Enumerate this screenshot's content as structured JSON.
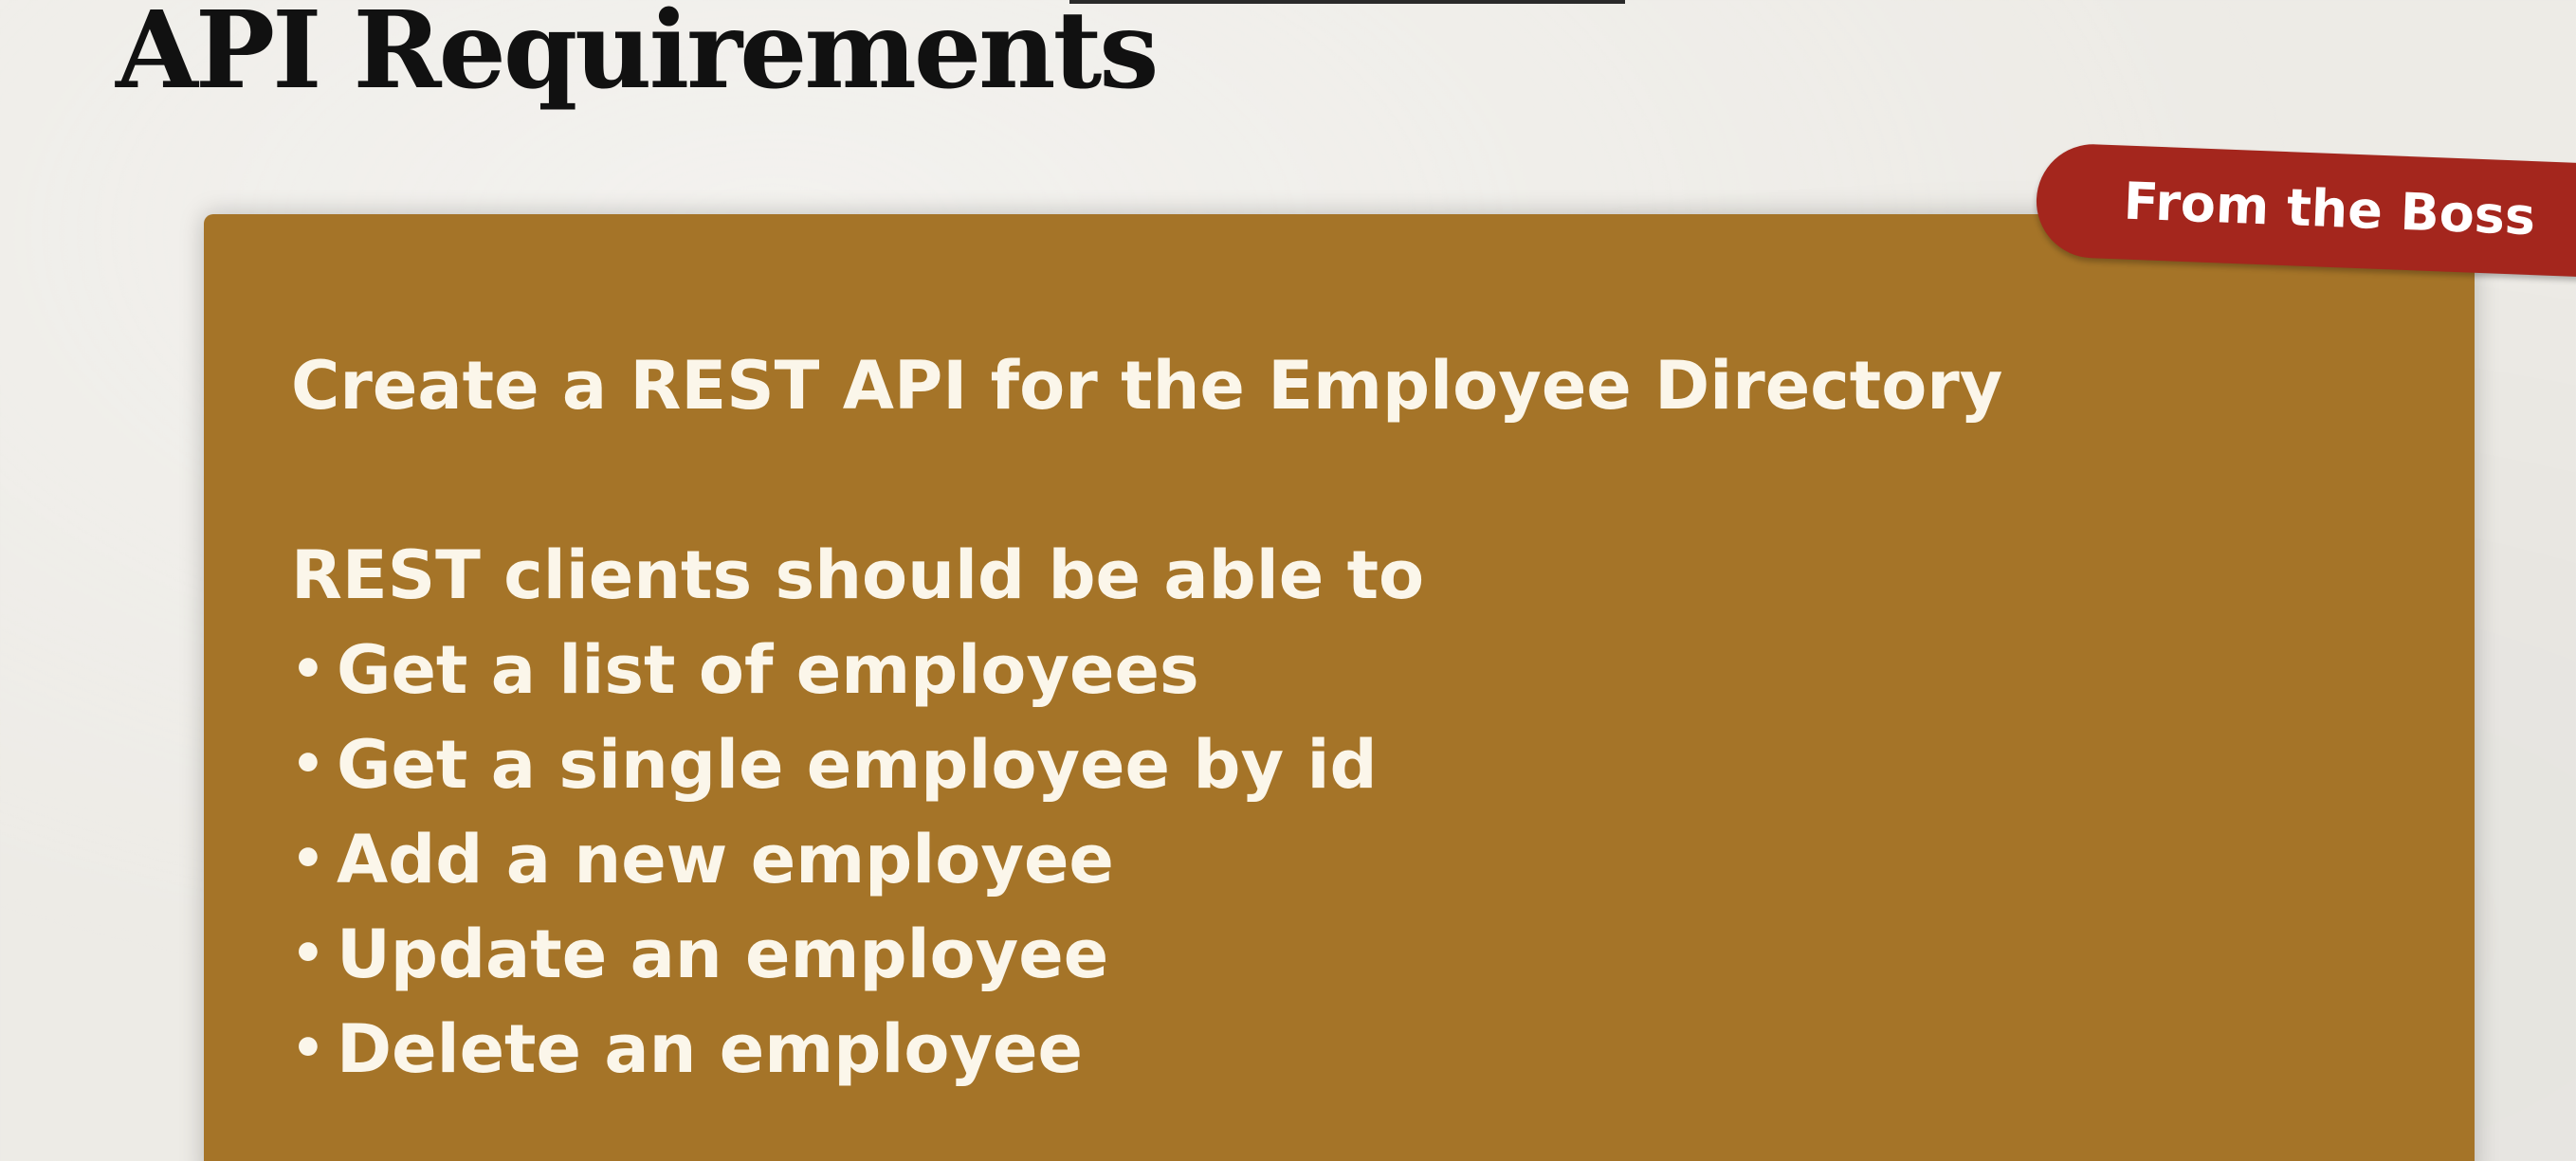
{
  "slide": {
    "title": "API Requirements"
  },
  "badge": {
    "label": "From the Boss"
  },
  "card": {
    "heading": "Create a REST API for the Employee Directory",
    "intro": "REST clients should be able to",
    "bullet_glyph": "•",
    "items": [
      "Get a list of employees",
      "Get a single employee by id",
      "Add a new employee",
      "Update an employee",
      "Delete an employee"
    ]
  },
  "colors": {
    "card_background": "#a57428",
    "badge_background": "#a4261d",
    "page_background": "#edebe6",
    "card_text": "#fbf6ea"
  }
}
